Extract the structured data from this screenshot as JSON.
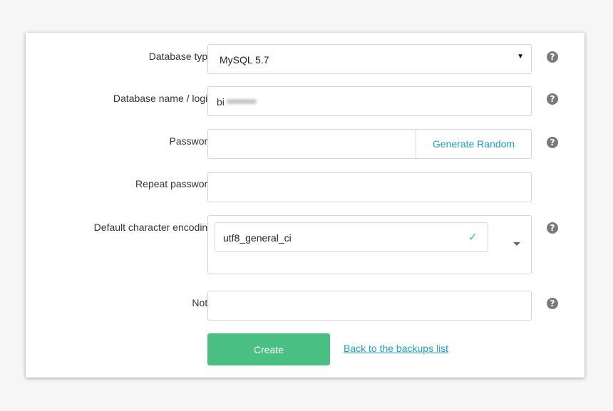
{
  "form": {
    "db_type": {
      "label": "Database type",
      "value": "MySQL 5.7"
    },
    "db_name": {
      "label": "Database name / login",
      "value": "bi"
    },
    "password": {
      "label": "Password",
      "value": "",
      "generate_label": "Generate Random"
    },
    "repeat_password": {
      "label": "Repeat password",
      "value": ""
    },
    "encoding": {
      "label": "Default character encoding",
      "value": "utf8_general_ci"
    },
    "note": {
      "label": "Note",
      "value": ""
    },
    "create_label": "Create",
    "back_link": "Back to the backups list"
  },
  "icons": {
    "help": "help-icon",
    "dropdown": "caret-down-icon",
    "check": "check-icon"
  },
  "colors": {
    "accent": "#49c082",
    "link": "#1ea0cf",
    "help": "#7a7a7a"
  }
}
